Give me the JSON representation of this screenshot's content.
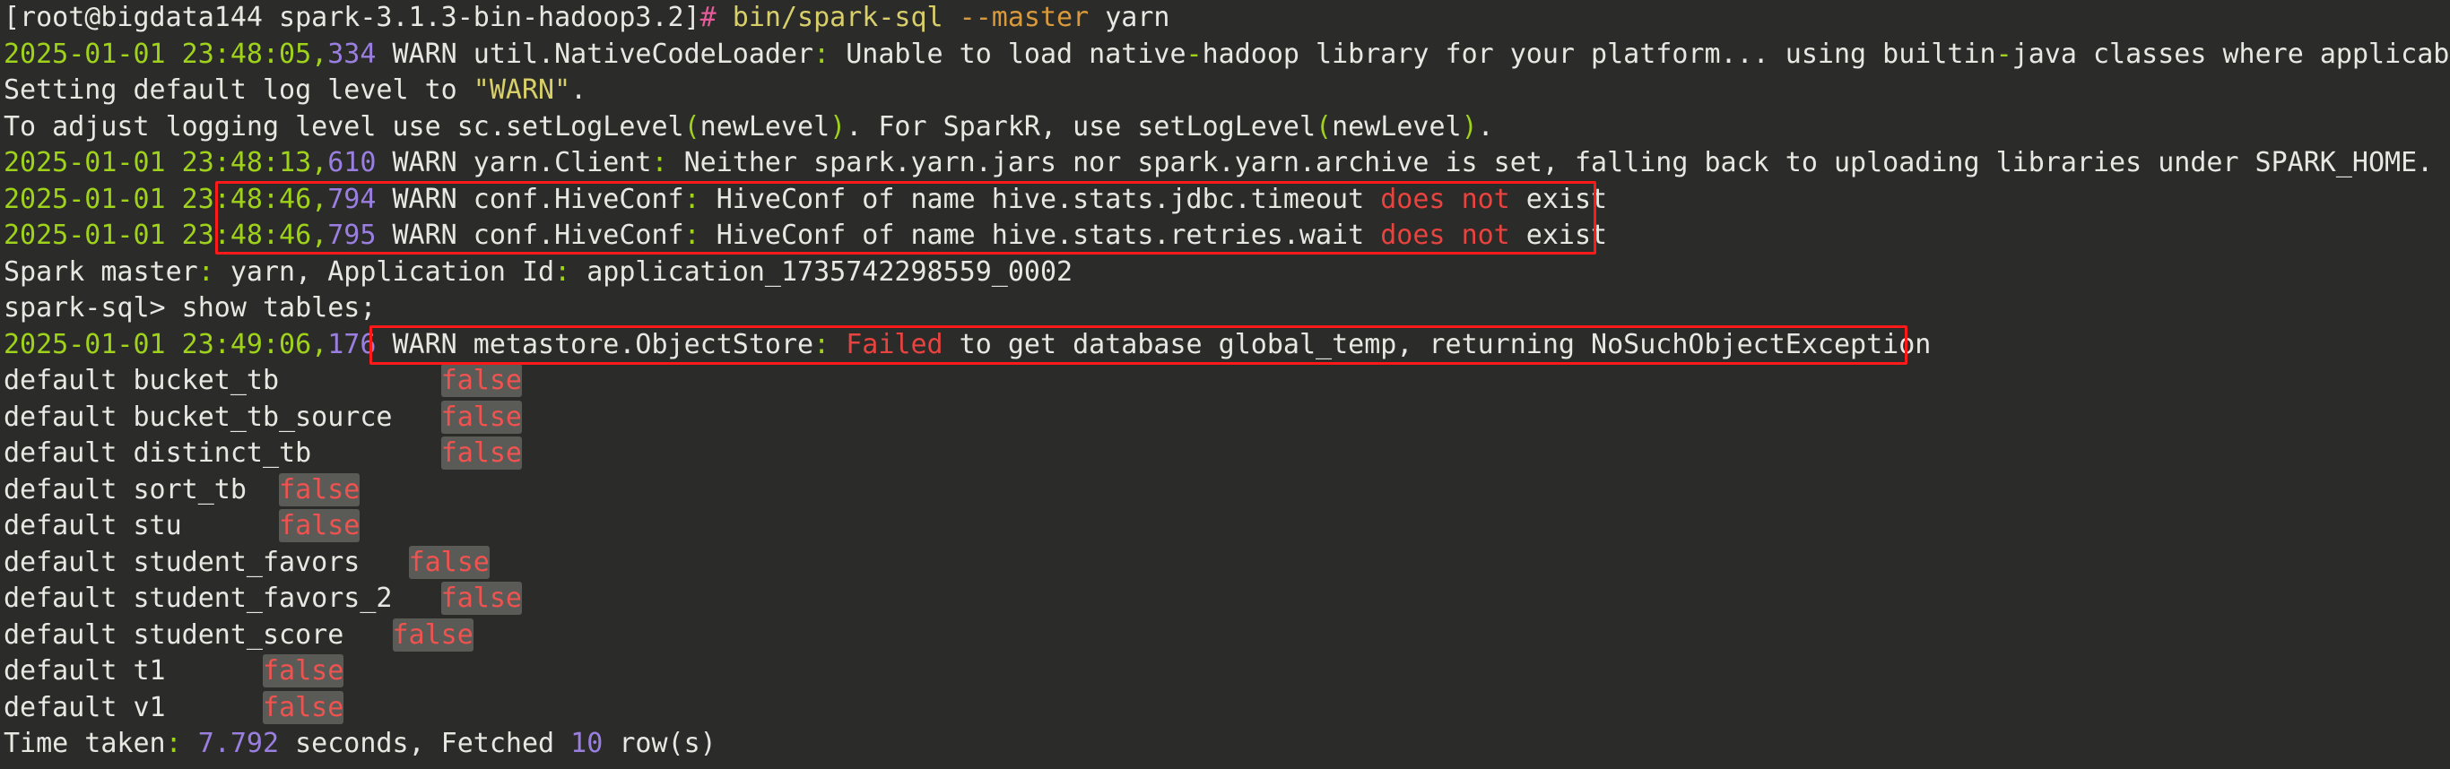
{
  "terminal": {
    "background_color": "#2b2b29",
    "foreground_color": "#e8e8e3",
    "colors": {
      "green": "#9fd21a",
      "violet": "#9a7fe0",
      "red": "#e8433f",
      "yellow": "#d8cf6a",
      "orange": "#d89a3a",
      "magenta": "#e45a9a",
      "highlight_bg": "#5a5a57",
      "annotation_box": "#ff1a1a"
    },
    "prompt": {
      "user_host_path": "[root@bigdata144 spark-3.1.3-bin-hadoop3.2]",
      "hash": "#",
      "command_binary": "bin/spark-sql",
      "command_flag": "--master",
      "command_arg": "yarn"
    },
    "lines": {
      "l1_prompt_prefix": "[root@bigdata144 spark-3.1.3-bin-hadoop3.2]",
      "l1_hash": "#",
      "l1_cmd": " bin/spark-sql ",
      "l1_flag": "--master",
      "l1_arg": " yarn",
      "l2_timestamp": "2025-01-01 23:48:05",
      "l2_comma": ",",
      "l2_millis": "334",
      "l2_a": " WARN util.NativeCodeLoader",
      "l2_colon": ":",
      "l2_b": " Unable to load native",
      "l2_dash1": "-",
      "l2_c": "hadoop library for your platform... using builtin",
      "l2_dash2": "-",
      "l2_d": "java classes where applicable",
      "l3_a": "Setting default log level to ",
      "l3_quoted": "\"WARN\"",
      "l3_b": ".",
      "l4_a": "To adjust logging level use sc.setLogLevel",
      "l4_p1": "(",
      "l4_b": "newLevel",
      "l4_p2": ")",
      "l4_c": ". For SparkR, use setLogLevel",
      "l4_p3": "(",
      "l4_d": "newLevel",
      "l4_p4": ")",
      "l4_e": ".",
      "l5_timestamp": "2025-01-01 23:48:13",
      "l5_comma": ",",
      "l5_millis": "610",
      "l5_a": " WARN yarn.Client",
      "l5_colon": ":",
      "l5_b": " Neither spark.yarn.jars nor spark.yarn.archive is set, falling back to uploading libraries under SPARK_HOME.",
      "l6_timestamp": "2025-01-01 23:48:46",
      "l6_comma": ",",
      "l6_millis": "794",
      "l6_a": " WARN conf.HiveConf",
      "l6_colon": ":",
      "l6_b": " HiveConf of name hive.stats.jdbc.timeout ",
      "l6_does": "does",
      "l6_sp1": " ",
      "l6_not": "not",
      "l6_exist": " exist",
      "l7_timestamp": "2025-01-01 23:48:46",
      "l7_comma": ",",
      "l7_millis": "795",
      "l7_a": " WARN conf.HiveConf",
      "l7_colon": ":",
      "l7_b": " HiveConf of name hive.stats.retries.wait ",
      "l7_does": "does",
      "l7_sp1": " ",
      "l7_not": "not",
      "l7_exist": " exist",
      "l8_a": "Spark master",
      "l8_colon1": ":",
      "l8_b": " yarn, Application Id",
      "l8_colon2": ":",
      "l8_c": " application_1735742298559_0002",
      "l9_prompt": "spark-sql>",
      "l9_cmd": " show tables;",
      "l10_timestamp": "2025-01-01 23:49:06",
      "l10_comma": ",",
      "l10_millis": "176",
      "l10_a": " WARN metastore.ObjectStore",
      "l10_colon": ":",
      "l10_sp": " ",
      "l10_failed": "Failed",
      "l10_b": " to get database global_temp, returning NoSuchObjectException",
      "l_last_a": "Time taken",
      "l_last_colon": ":",
      "l_last_sp1": " ",
      "l_last_secs": "7.792",
      "l_last_b": " seconds, Fetched ",
      "l_last_rows": "10",
      "l_last_c": " row(s)"
    },
    "table_listing": {
      "rows": [
        {
          "database": "default",
          "table": "bucket_tb",
          "pad": "          ",
          "is_temporary": "false"
        },
        {
          "database": "default",
          "table": "bucket_tb_source",
          "pad": "   ",
          "is_temporary": "false"
        },
        {
          "database": "default",
          "table": "distinct_tb",
          "pad": "        ",
          "is_temporary": "false"
        },
        {
          "database": "default",
          "table": "sort_tb",
          "pad": "  ",
          "is_temporary": "false"
        },
        {
          "database": "default",
          "table": "stu",
          "pad": "      ",
          "is_temporary": "false"
        },
        {
          "database": "default",
          "table": "student_favors",
          "pad": "   ",
          "is_temporary": "false"
        },
        {
          "database": "default",
          "table": "student_favors_2",
          "pad": "   ",
          "is_temporary": "false"
        },
        {
          "database": "default",
          "table": "student_score",
          "pad": "   ",
          "is_temporary": "false"
        },
        {
          "database": "default",
          "table": "t1",
          "pad": "      ",
          "is_temporary": "false"
        },
        {
          "database": "default",
          "table": "v1",
          "pad": "      ",
          "is_temporary": "false"
        }
      ]
    },
    "annotations": [
      {
        "name": "hiveconf-warning-box",
        "color": "#ff1a1a"
      },
      {
        "name": "metastore-warning-box",
        "color": "#ff1a1a"
      }
    ]
  }
}
